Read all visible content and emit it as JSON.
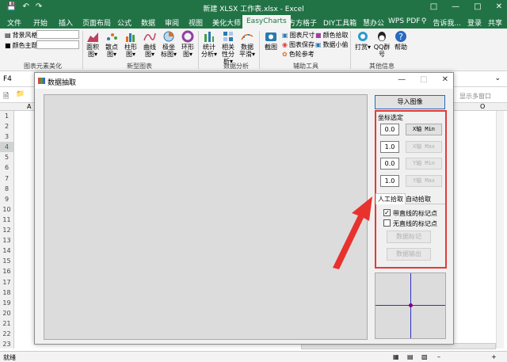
{
  "app": {
    "window_title": "新建 XLSX 工作表.xlsx - Excel",
    "sign_in": "登录",
    "share": "共享",
    "accent": "#217346"
  },
  "ribbon_tabs": [
    "文件",
    "开始",
    "插入",
    "页面布局",
    "公式",
    "数据",
    "审阅",
    "视图",
    "美化大师",
    "EasyCharts",
    "方方格子",
    "DIY工具箱",
    "慧办公",
    "WPS PDF"
  ],
  "tell_me": "告诉我...",
  "ribbon": {
    "chart_style_groups": {
      "bg_style": "背景风格",
      "color_theme": "颜色主题",
      "group1_label": "图表元素美化",
      "group2_label": "新型图表",
      "group3_label": "数据分析",
      "group4_label": "辅助工具",
      "group5_label": "其他信息"
    },
    "new_charts": [
      "面积图▾",
      "散点图▾",
      "柱形图▾",
      "曲线图▾",
      "极坐标图▾",
      "环形图▾"
    ],
    "analysis": [
      "统计分析▾",
      "相关性分析▾",
      "数据平滑▾"
    ],
    "aux": {
      "screenshot": "截图",
      "chart_size": "图表尺寸",
      "chart_save": "图表保存",
      "color_ref": "色轮参考",
      "color_pick": "颜色拾取",
      "data_mini": "数据小偷"
    },
    "other": [
      "打赏▾",
      "QQ群号",
      "帮助"
    ]
  },
  "formula_bar": {
    "cell_ref": "F4"
  },
  "sheet_toolbar": {
    "show_multi": "显示多窗口"
  },
  "grid": {
    "col_a": "A",
    "col_o": "O",
    "rows": [
      "1",
      "2",
      "3",
      "4",
      "5",
      "6",
      "7",
      "8",
      "9",
      "10",
      "11",
      "12",
      "13",
      "14",
      "15",
      "16",
      "17",
      "18",
      "19",
      "20",
      "21",
      "22",
      "23"
    ]
  },
  "dialog": {
    "title": "数据抽取",
    "import_button": "导入图像",
    "coord_section": "坐标选定",
    "x_min": {
      "value": "0.0",
      "button": "X轴 Min"
    },
    "x_max": {
      "value": "1.0",
      "button": "X轴 Max"
    },
    "y_min": {
      "value": "0.0",
      "button": "Y轴 Min"
    },
    "y_max": {
      "value": "1.0",
      "button": "Y轴 Max"
    },
    "tab_manual": "人工拾取",
    "tab_auto": "自动拾取",
    "check_with_line": "带直线的标记点",
    "check_without_line": "无直线的标记点",
    "check_with_line_checked": true,
    "check_without_line_checked": false,
    "mark_button": "数据标记",
    "export_button": "数据输出"
  },
  "status": {
    "ready": "就绪"
  }
}
